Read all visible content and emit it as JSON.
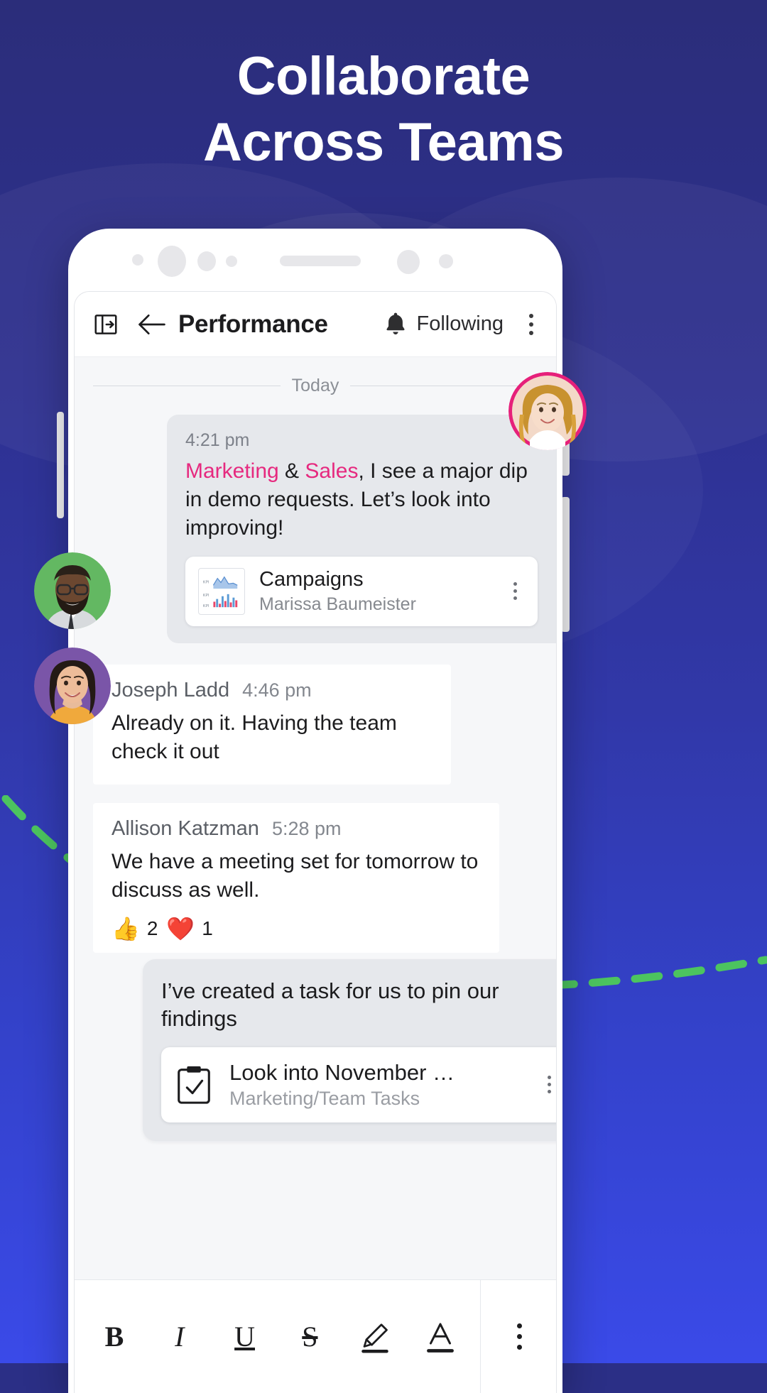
{
  "headline": {
    "line1": "Collaborate",
    "line2": "Across Teams"
  },
  "colors": {
    "background_top": "#2b2d7a",
    "background_bottom": "#3a4ae8",
    "mention_pink": "#e6297f",
    "dash_green": "#4cc45f",
    "avatar_ring_pink": "#e6207a",
    "avatar_ring_green": "#63b862",
    "avatar_ring_purple": "#7a55a8"
  },
  "toolbar": {
    "panel_icon": "panel-expand-icon",
    "back_icon": "back-arrow-icon",
    "title": "Performance",
    "bell_icon": "bell-icon",
    "following_label": "Following",
    "overflow_icon": "kebab-menu-icon"
  },
  "thread": {
    "day_divider": "Today",
    "messages": [
      {
        "time": "4:21 pm",
        "segments": [
          {
            "text": "Marketing",
            "style": "mention"
          },
          {
            "text": " & ",
            "style": "plain"
          },
          {
            "text": "Sales",
            "style": "mention"
          },
          {
            "text": ", I see a major dip in demo requests. Let’s look into improving!",
            "style": "plain"
          }
        ],
        "attachment": {
          "thumb_icon": "kpi-dashboard-thumbnail",
          "title": "Campaigns",
          "subtitle": "Marissa Baumeister",
          "overflow_icon": "kebab-menu-icon"
        }
      },
      {
        "author": "Joseph Ladd",
        "time": "4:46 pm",
        "text": "Already on it. Having the team check it out"
      },
      {
        "author": "Allison Katzman",
        "time": "5:28 pm",
        "text": "We have a meeting set for tomorrow to discuss as well.",
        "reactions": [
          {
            "emoji": "👍",
            "name": "thumbs-up-reaction",
            "count": "2"
          },
          {
            "emoji": "❤️",
            "name": "heart-reaction",
            "count": "1"
          }
        ]
      }
    ],
    "task_message": {
      "text": "I’ve created a task for us to pin our findings",
      "card": {
        "icon": "clipboard-check-icon",
        "title": "Look into November …",
        "subtitle": "Marketing/Team Tasks",
        "overflow_icon": "kebab-menu-icon"
      }
    }
  },
  "format_toolbar": {
    "buttons": [
      {
        "label": "B",
        "name": "bold-button"
      },
      {
        "label": "I",
        "name": "italic-button"
      },
      {
        "label": "U",
        "name": "underline-button"
      },
      {
        "label": "S",
        "name": "strikethrough-button"
      },
      {
        "label": "",
        "name": "highlighter-button"
      },
      {
        "label": "",
        "name": "text-color-button"
      }
    ],
    "overflow_icon": "kebab-menu-icon"
  },
  "avatars": [
    {
      "name": "avatar-marissa-baumeister",
      "ring": "#e6207a"
    },
    {
      "name": "avatar-joseph-ladd",
      "ring": "#63b862"
    },
    {
      "name": "avatar-allison-katzman",
      "ring": "#7a55a8"
    }
  ]
}
